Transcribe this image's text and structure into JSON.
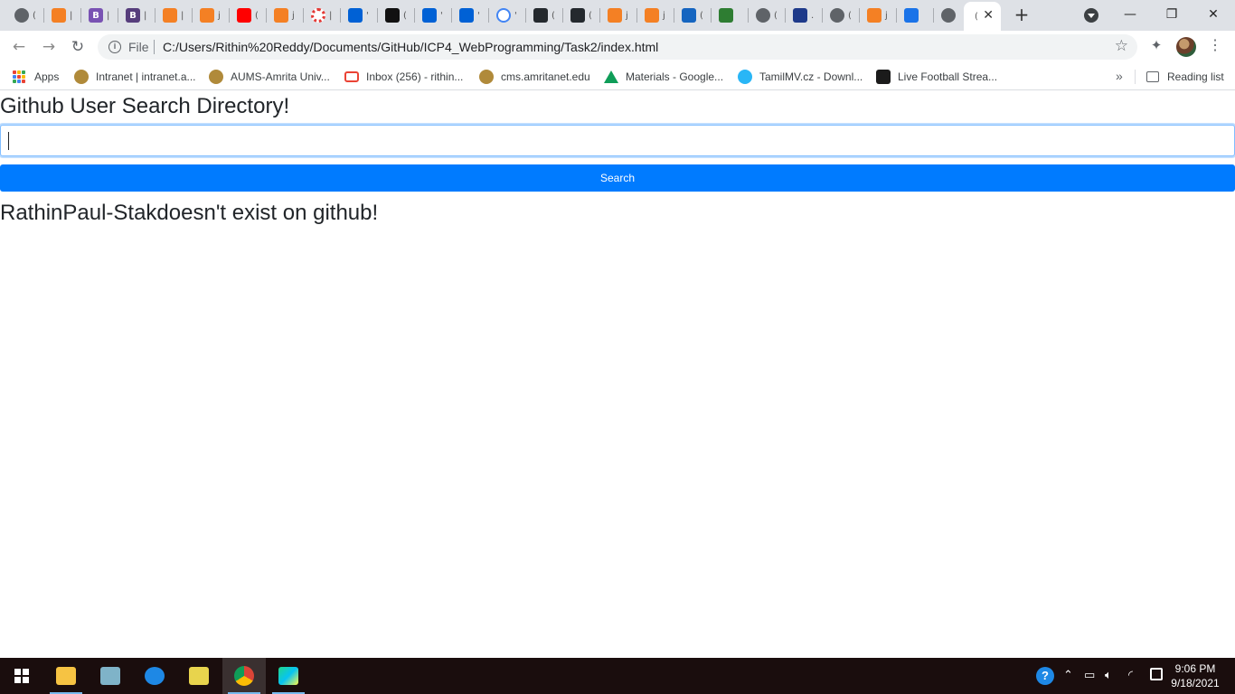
{
  "browser": {
    "tabs": [
      {
        "icon": "globe-icon",
        "color": "#5f6368",
        "frag": "("
      },
      {
        "icon": "stackoverflow-icon",
        "color": "#f48024",
        "frag": "|"
      },
      {
        "icon": "bootstrap-icon",
        "color": "#7952b3",
        "glyph": "B",
        "frag": "|"
      },
      {
        "icon": "bootstrap-icon",
        "color": "#563d7c",
        "glyph": "B",
        "frag": "|"
      },
      {
        "icon": "stackoverflow-icon",
        "color": "#f48024",
        "frag": "|"
      },
      {
        "icon": "stackoverflow-icon",
        "color": "#f48024",
        "frag": "j"
      },
      {
        "icon": "youtube-icon",
        "color": "#ff0000",
        "frag": "("
      },
      {
        "icon": "stackoverflow-icon",
        "color": "#f48024",
        "frag": "j"
      },
      {
        "icon": "lifebuoy-icon",
        "color": "#e53935",
        "frag": "|"
      },
      {
        "icon": "box-icon",
        "color": "#0061d5",
        "frag": "'"
      },
      {
        "icon": "codepen-icon",
        "color": "#111111",
        "frag": "("
      },
      {
        "icon": "box-icon",
        "color": "#0061d5",
        "frag": "'"
      },
      {
        "icon": "box-icon",
        "color": "#0061d5",
        "frag": "'"
      },
      {
        "icon": "google-icon",
        "color": "#4285f4",
        "frag": "'"
      },
      {
        "icon": "github-icon",
        "color": "#24292e",
        "frag": "("
      },
      {
        "icon": "github-icon",
        "color": "#24292e",
        "frag": "("
      },
      {
        "icon": "stackoverflow-icon",
        "color": "#f48024",
        "frag": "j"
      },
      {
        "icon": "stackoverflow-icon",
        "color": "#f48024",
        "frag": "j"
      },
      {
        "icon": "check-icon",
        "color": "#1565c0",
        "frag": "("
      },
      {
        "icon": "sixty-icon",
        "color": "#2e7d32",
        "frag": ""
      },
      {
        "icon": "globe-icon",
        "color": "#5f6368",
        "frag": "("
      },
      {
        "icon": "moon-icon",
        "color": "#1e3a8a",
        "frag": "."
      },
      {
        "icon": "globe-icon",
        "color": "#5f6368",
        "frag": "("
      },
      {
        "icon": "stackoverflow-icon",
        "color": "#f48024",
        "frag": "j"
      },
      {
        "icon": "download-icon",
        "color": "#1a73e8",
        "frag": ""
      },
      {
        "icon": "globe-icon",
        "color": "#5f6368",
        "frag": ""
      }
    ],
    "active_tab_frag": "(",
    "url_scheme_label": "File",
    "url": "C:/Users/Rithin%20Reddy/Documents/GitHub/ICP4_WebProgramming/Task2/index.html",
    "bookmarks": [
      {
        "label": "Apps",
        "icon": "apps-icon"
      },
      {
        "label": "Intranet | intranet.a...",
        "icon": "amrita-icon",
        "color": "#b08a3a"
      },
      {
        "label": "AUMS-Amrita Univ...",
        "icon": "amrita-icon",
        "color": "#b08a3a"
      },
      {
        "label": "Inbox (256) - rithin...",
        "icon": "gmail-icon",
        "color": "#ea4335"
      },
      {
        "label": "cms.amritanet.edu",
        "icon": "amrita-icon",
        "color": "#b08a3a"
      },
      {
        "label": "Materials - Google...",
        "icon": "drive-icon",
        "color": "#0f9d58"
      },
      {
        "label": "TamilMV.cz - Downl...",
        "icon": "play-icon",
        "color": "#29b6f6"
      },
      {
        "label": "Live Football Strea...",
        "icon": "football-icon",
        "color": "#1b1b1b"
      }
    ],
    "reading_list_label": "Reading list"
  },
  "page": {
    "heading": "Github User Search Directory!",
    "search_value": "",
    "search_button_label": "Search",
    "result_message": "RathinPaul-Stakdoesn't exist on github!"
  },
  "taskbar": {
    "apps": [
      {
        "name": "start-button",
        "icon": "windows-icon"
      },
      {
        "name": "file-explorer",
        "icon": "folder-icon",
        "color": "#f6c343",
        "open": true
      },
      {
        "name": "app-pen",
        "icon": "pen-icon",
        "color": "#7fb3c8"
      },
      {
        "name": "app-sync",
        "icon": "sync-icon",
        "color": "#1e88e5"
      },
      {
        "name": "app-notes",
        "icon": "notes-icon",
        "color": "#e8d44d"
      },
      {
        "name": "chrome",
        "icon": "chrome-icon",
        "color": "#db4437",
        "open": true,
        "active": true
      },
      {
        "name": "webstorm",
        "icon": "webstorm-icon",
        "color": "#21d789",
        "open": true
      }
    ],
    "time": "9:06 PM",
    "date": "9/18/2021"
  }
}
